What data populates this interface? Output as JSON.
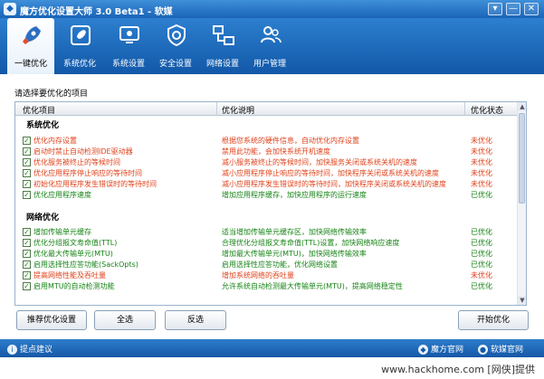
{
  "window": {
    "title": "魔方优化设置大师 3.0 Beta1 - 软媒",
    "buttons": [
      "▾",
      "—",
      "✕"
    ]
  },
  "nav": {
    "tabs": [
      {
        "label": "一键优化",
        "icon": "rocket-icon",
        "active": true
      },
      {
        "label": "系统优化",
        "icon": "rocket-card-icon"
      },
      {
        "label": "系统设置",
        "icon": "monitor-settings-icon"
      },
      {
        "label": "安全设置",
        "icon": "shield-gear-icon"
      },
      {
        "label": "网络设置",
        "icon": "network-icon"
      },
      {
        "label": "用户管理",
        "icon": "users-icon"
      }
    ]
  },
  "hint": "请选择要优化的项目",
  "table": {
    "headers": [
      "优化项目",
      "优化说明",
      "优化状态"
    ],
    "sections": [
      {
        "title": "系统优化",
        "rows": [
          {
            "name": "优化内存设置",
            "desc": "根据您系统的硬件信息，自动优化内存设置",
            "status": "未优化",
            "color": "#e0421b"
          },
          {
            "name": "启动时禁止自动检测IDE驱动器",
            "desc": "禁用此功能，会加快系统开机速度",
            "status": "未优化",
            "color": "#e0421b"
          },
          {
            "name": "优化服务被终止的等候时间",
            "desc": "减小服务被终止的等候时间，加快服务关闭或系统关机的速度",
            "status": "未优化",
            "color": "#e0421b"
          },
          {
            "name": "优化应用程序停止响应的等待时间",
            "desc": "减小应用程序停止响应的等待时间，加快程序关闭或系统关机的速度",
            "status": "未优化",
            "color": "#e0421b"
          },
          {
            "name": "初始化应用程序发生错误时的等待时间",
            "desc": "减小应用程序发生错误时的等待时间，加快程序关闭或系统关机的速度",
            "status": "未优化",
            "color": "#e0421b"
          },
          {
            "name": "优化应用程序速度",
            "desc": "增加应用程序缓存，加快应用程序的运行速度",
            "status": "已优化",
            "color": "#178417"
          }
        ]
      },
      {
        "title": "网络优化",
        "rows": [
          {
            "name": "增加传输单元缓存",
            "desc": "适当增加传输单元缓存区，加快网络传输效率",
            "status": "已优化",
            "color": "#178417"
          },
          {
            "name": "优化分组报文寿命值(TTL)",
            "desc": "合理优化分组报文寿命值(TTL)设置，加快网络响应速度",
            "status": "已优化",
            "color": "#178417"
          },
          {
            "name": "优化最大传输单元(MTU)",
            "desc": "增加最大传输单元(MTU)，加快网络传输效率",
            "status": "已优化",
            "color": "#178417"
          },
          {
            "name": "启用选择性应答功能(SackOpts)",
            "desc": "启用选择性应答功能，优化网络设置",
            "status": "已优化",
            "color": "#178417"
          },
          {
            "name": "提高网络性能及吞吐量",
            "desc": "增加系统网络的吞吐量",
            "status": "未优化",
            "color": "#e0421b"
          },
          {
            "name": "启用MTU的自动检测功能",
            "desc": "允许系统自动检测最大传输单元(MTU)，提高网络稳定性",
            "status": "已优化",
            "color": "#178417"
          }
        ]
      }
    ]
  },
  "buttons": {
    "recommend": "推荐优化设置",
    "select_all": "全选",
    "invert": "反选",
    "start": "开始优化"
  },
  "statusbar": {
    "suggest": "提点建议",
    "site1": "魔方官网",
    "site2": "软媒官网"
  },
  "watermark": "www.hackhome.com [网侠]提供"
}
